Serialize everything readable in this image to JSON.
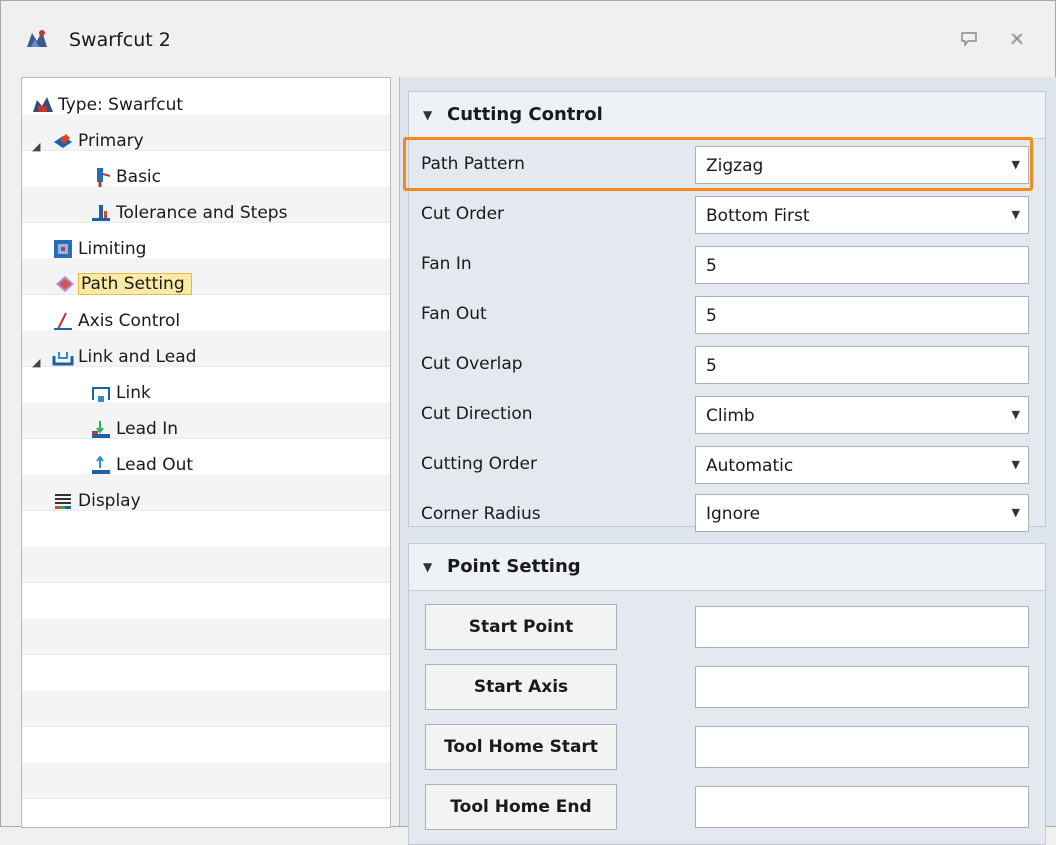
{
  "window": {
    "title": "Swarfcut 2",
    "buttons": [
      "pin-button",
      "close-button"
    ]
  },
  "tree": {
    "items": [
      {
        "label": "Type: Swarfcut",
        "icon": "swarfcut-type-icon"
      },
      {
        "label": "Primary",
        "icon": "primary-part-icon",
        "expander": "◢"
      },
      {
        "label": "Basic",
        "icon": "basic-tool-icon"
      },
      {
        "label": "Tolerance and Steps",
        "icon": "tolerance-steps-icon"
      },
      {
        "label": "Limiting",
        "icon": "limiting-icon"
      },
      {
        "label": "Path Setting",
        "icon": "path-setting-icon",
        "selected": true
      },
      {
        "label": "Axis Control",
        "icon": "axis-control-icon"
      },
      {
        "label": "Link and Lead",
        "icon": "link-lead-icon",
        "expander": "◢"
      },
      {
        "label": "Link",
        "icon": "link-icon"
      },
      {
        "label": "Lead In",
        "icon": "lead-in-icon"
      },
      {
        "label": "Lead Out",
        "icon": "lead-out-icon"
      },
      {
        "label": "Display",
        "icon": "display-icon"
      }
    ]
  },
  "cutting_control": {
    "title": "Cutting Control",
    "rows": [
      {
        "label": "Path Pattern",
        "value": "Zigzag",
        "dropdown": true
      },
      {
        "label": "Cut Order",
        "value": "Bottom First",
        "dropdown": true
      },
      {
        "label": "Fan In",
        "value": "5",
        "dropdown": false
      },
      {
        "label": "Fan Out",
        "value": "5",
        "dropdown": false
      },
      {
        "label": "Cut Overlap",
        "value": "5",
        "dropdown": false
      },
      {
        "label": "Cut Direction",
        "value": "Climb",
        "dropdown": true
      },
      {
        "label": "Cutting Order",
        "value": "Automatic",
        "dropdown": true
      },
      {
        "label": "Corner Radius",
        "value": "Ignore",
        "dropdown": true
      }
    ]
  },
  "point_setting": {
    "title": "Point Setting",
    "buttons": [
      {
        "label": "Start Point",
        "value": ""
      },
      {
        "label": "Start Axis",
        "value": ""
      },
      {
        "label": "Tool Home Start",
        "value": ""
      },
      {
        "label": "Tool Home End",
        "value": ""
      }
    ]
  },
  "colors": {
    "highlight": "#f08a18",
    "selection_fill": "#fbe9a6",
    "panel_bg": "#dde4ed"
  }
}
